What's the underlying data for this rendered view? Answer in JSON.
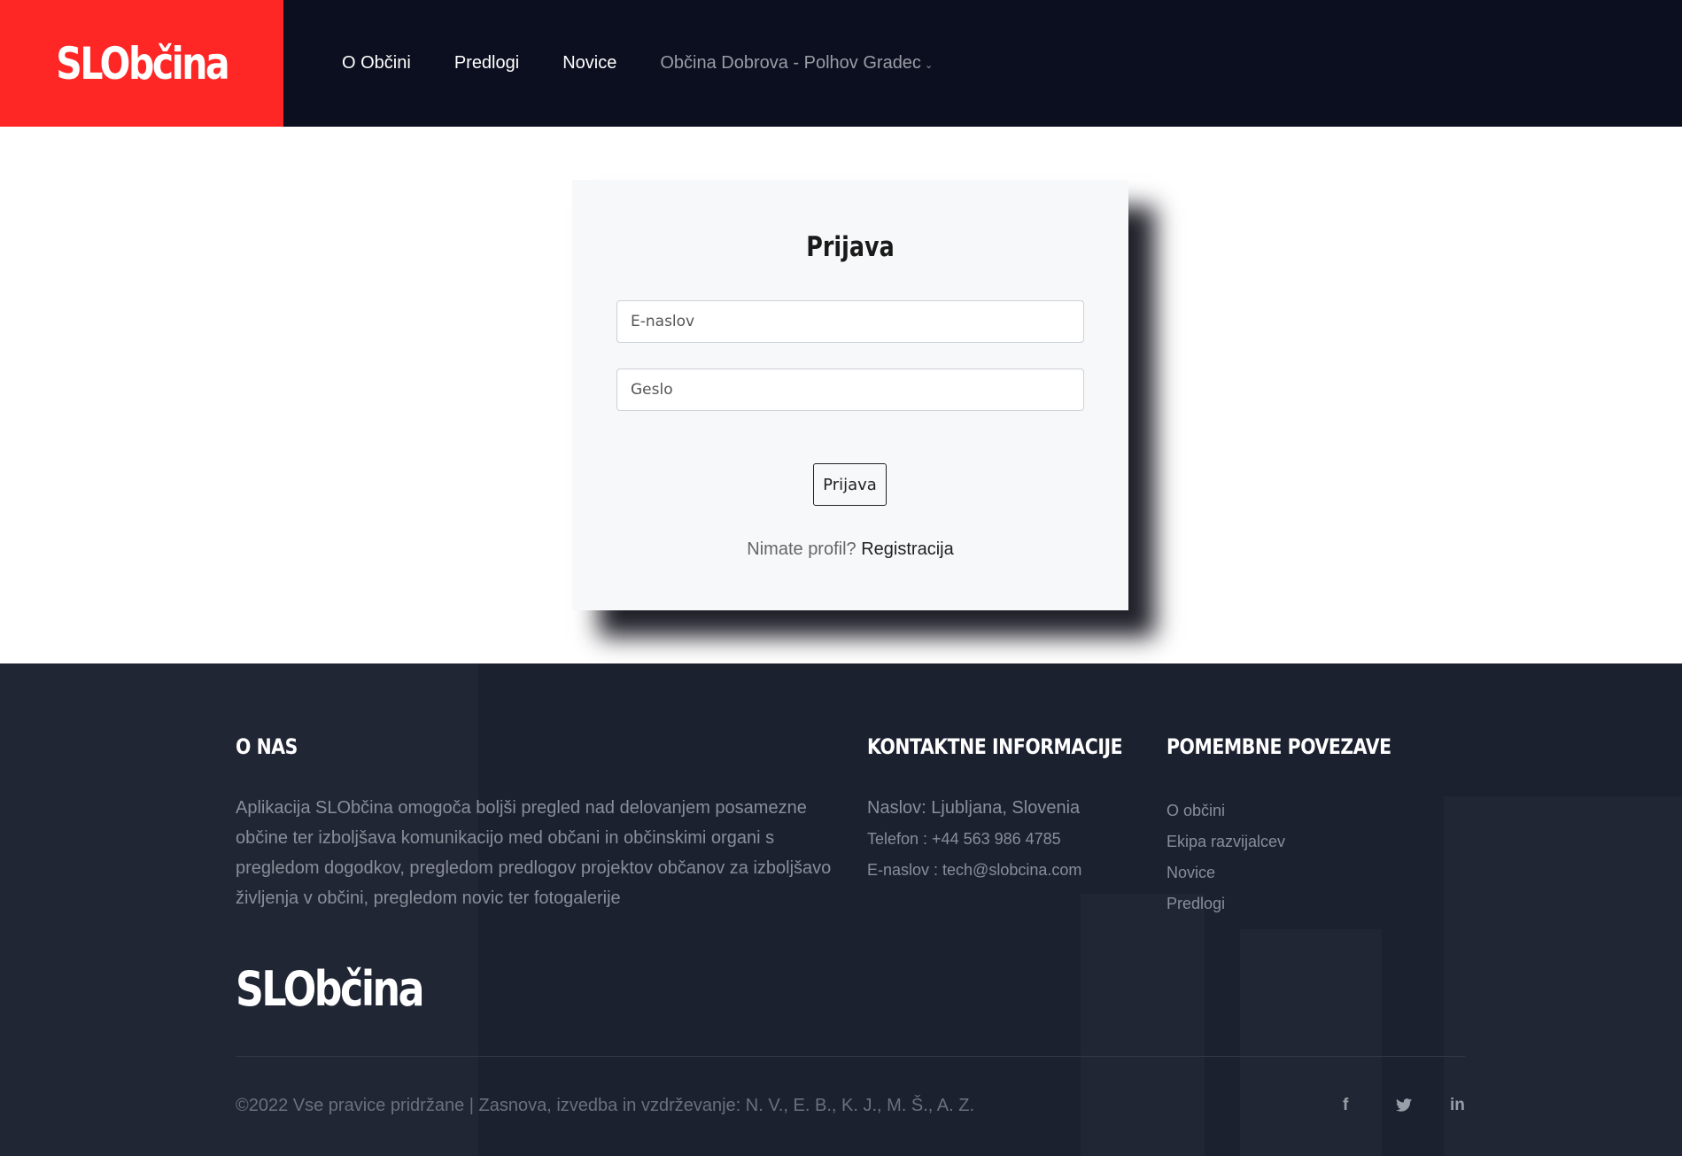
{
  "header": {
    "logo": "SLObčina",
    "nav": [
      {
        "label": "O Občini"
      },
      {
        "label": "Predlogi"
      },
      {
        "label": "Novice"
      },
      {
        "label": "Občina Dobrova - Polhov Gradec"
      }
    ],
    "dropdown_icon": "chevron-down-icon"
  },
  "login": {
    "title": "Prijava",
    "email_placeholder": "E-naslov",
    "password_placeholder": "Geslo",
    "submit_label": "Prijava",
    "no_profile_text": "Nimate profil?",
    "register_link": "Registracija"
  },
  "footer": {
    "about": {
      "heading": "O NAS",
      "text": "Aplikacija SLObčina omogoča boljši pregled nad delovanjem posamezne občine ter izboljšava komunikacijo med občani in občinskimi organi s pregledom dogodkov, pregledom predlogov projektov občanov za izboljšavo življenja v občini, pregledom novic ter fotogalerije"
    },
    "contact": {
      "heading": "KONTAKTNE INFORMACIJE",
      "address": "Naslov: Ljubljana, Slovenia",
      "phone": "Telefon : +44 563 986 4785",
      "email": "E-naslov : tech@slobcina.com"
    },
    "links": {
      "heading": "POMEMBNE POVEZAVE",
      "items": [
        "O občini",
        "Ekipa razvijalcev",
        "Novice",
        "Predlogi"
      ]
    },
    "logo": "SLObčina",
    "copyright": "©2022 Vse pravice pridržane | Zasnova, izvedba in vzdrževanje: N. V., E. B., K. J., M. Š., A. Z.",
    "social": [
      "facebook-icon",
      "twitter-icon",
      "linkedin-icon"
    ]
  },
  "colors": {
    "brand_red": "#ff2626",
    "header_bg": "#0c0f1f",
    "footer_bg": "#1c2130"
  }
}
